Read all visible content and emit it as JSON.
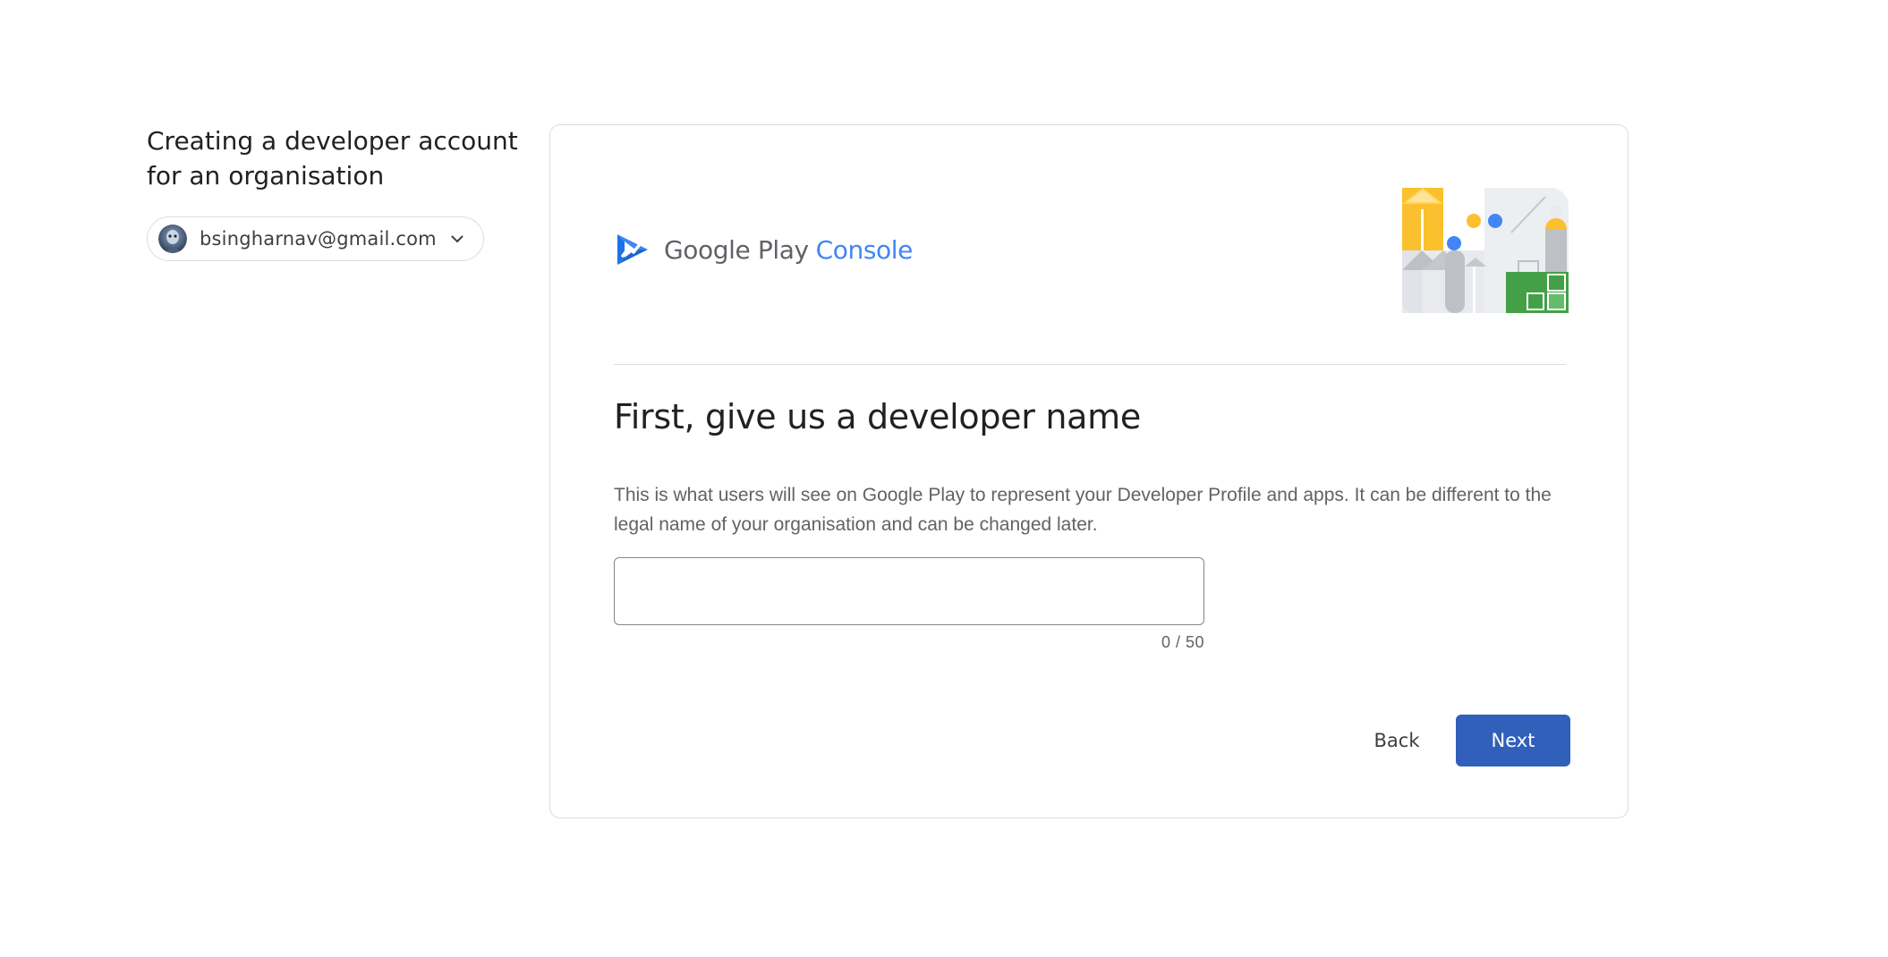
{
  "sidebar": {
    "title": "Creating a developer account for an organisation",
    "account": {
      "email": "bsingharnav@gmail.com",
      "avatar_icon": "user-avatar",
      "dropdown_icon": "chevron-down-icon"
    }
  },
  "brand": {
    "logo_icon": "google-play-console-logo",
    "name_primary": "Google Play",
    "name_secondary": "Console",
    "colors": {
      "primary_text": "#5f6368",
      "secondary_text": "#4285f4"
    }
  },
  "form": {
    "heading": "First, give us a developer name",
    "description": "This is what users will see on Google Play to represent your Developer Profile and apps. It can be different to the legal name of your organisation and can be changed later.",
    "developer_name": {
      "value": "",
      "placeholder": "",
      "counter": "0 / 50"
    }
  },
  "actions": {
    "back_label": "Back",
    "next_label": "Next",
    "accent_color": "#3160ba"
  }
}
